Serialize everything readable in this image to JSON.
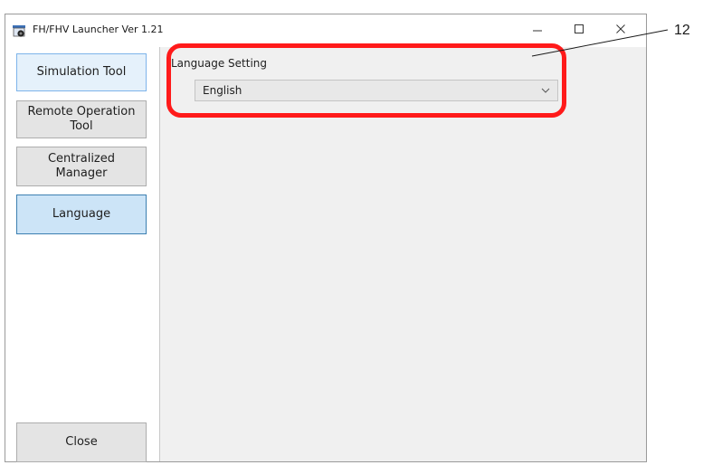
{
  "window": {
    "title": "FH/FHV Launcher Ver 1.21",
    "controls": {
      "minimize": "—",
      "maximize": "☐",
      "close": "✕"
    }
  },
  "sidebar": {
    "items": [
      {
        "label": "Simulation Tool"
      },
      {
        "label": "Remote Operation Tool"
      },
      {
        "label": "Centralized Manager"
      },
      {
        "label": "Language"
      }
    ],
    "close_label": "Close"
  },
  "content": {
    "language_label": "Language Setting",
    "language_value": "English"
  },
  "annotation": {
    "callout_number": "12",
    "highlight_color": "#ff1a1a"
  }
}
